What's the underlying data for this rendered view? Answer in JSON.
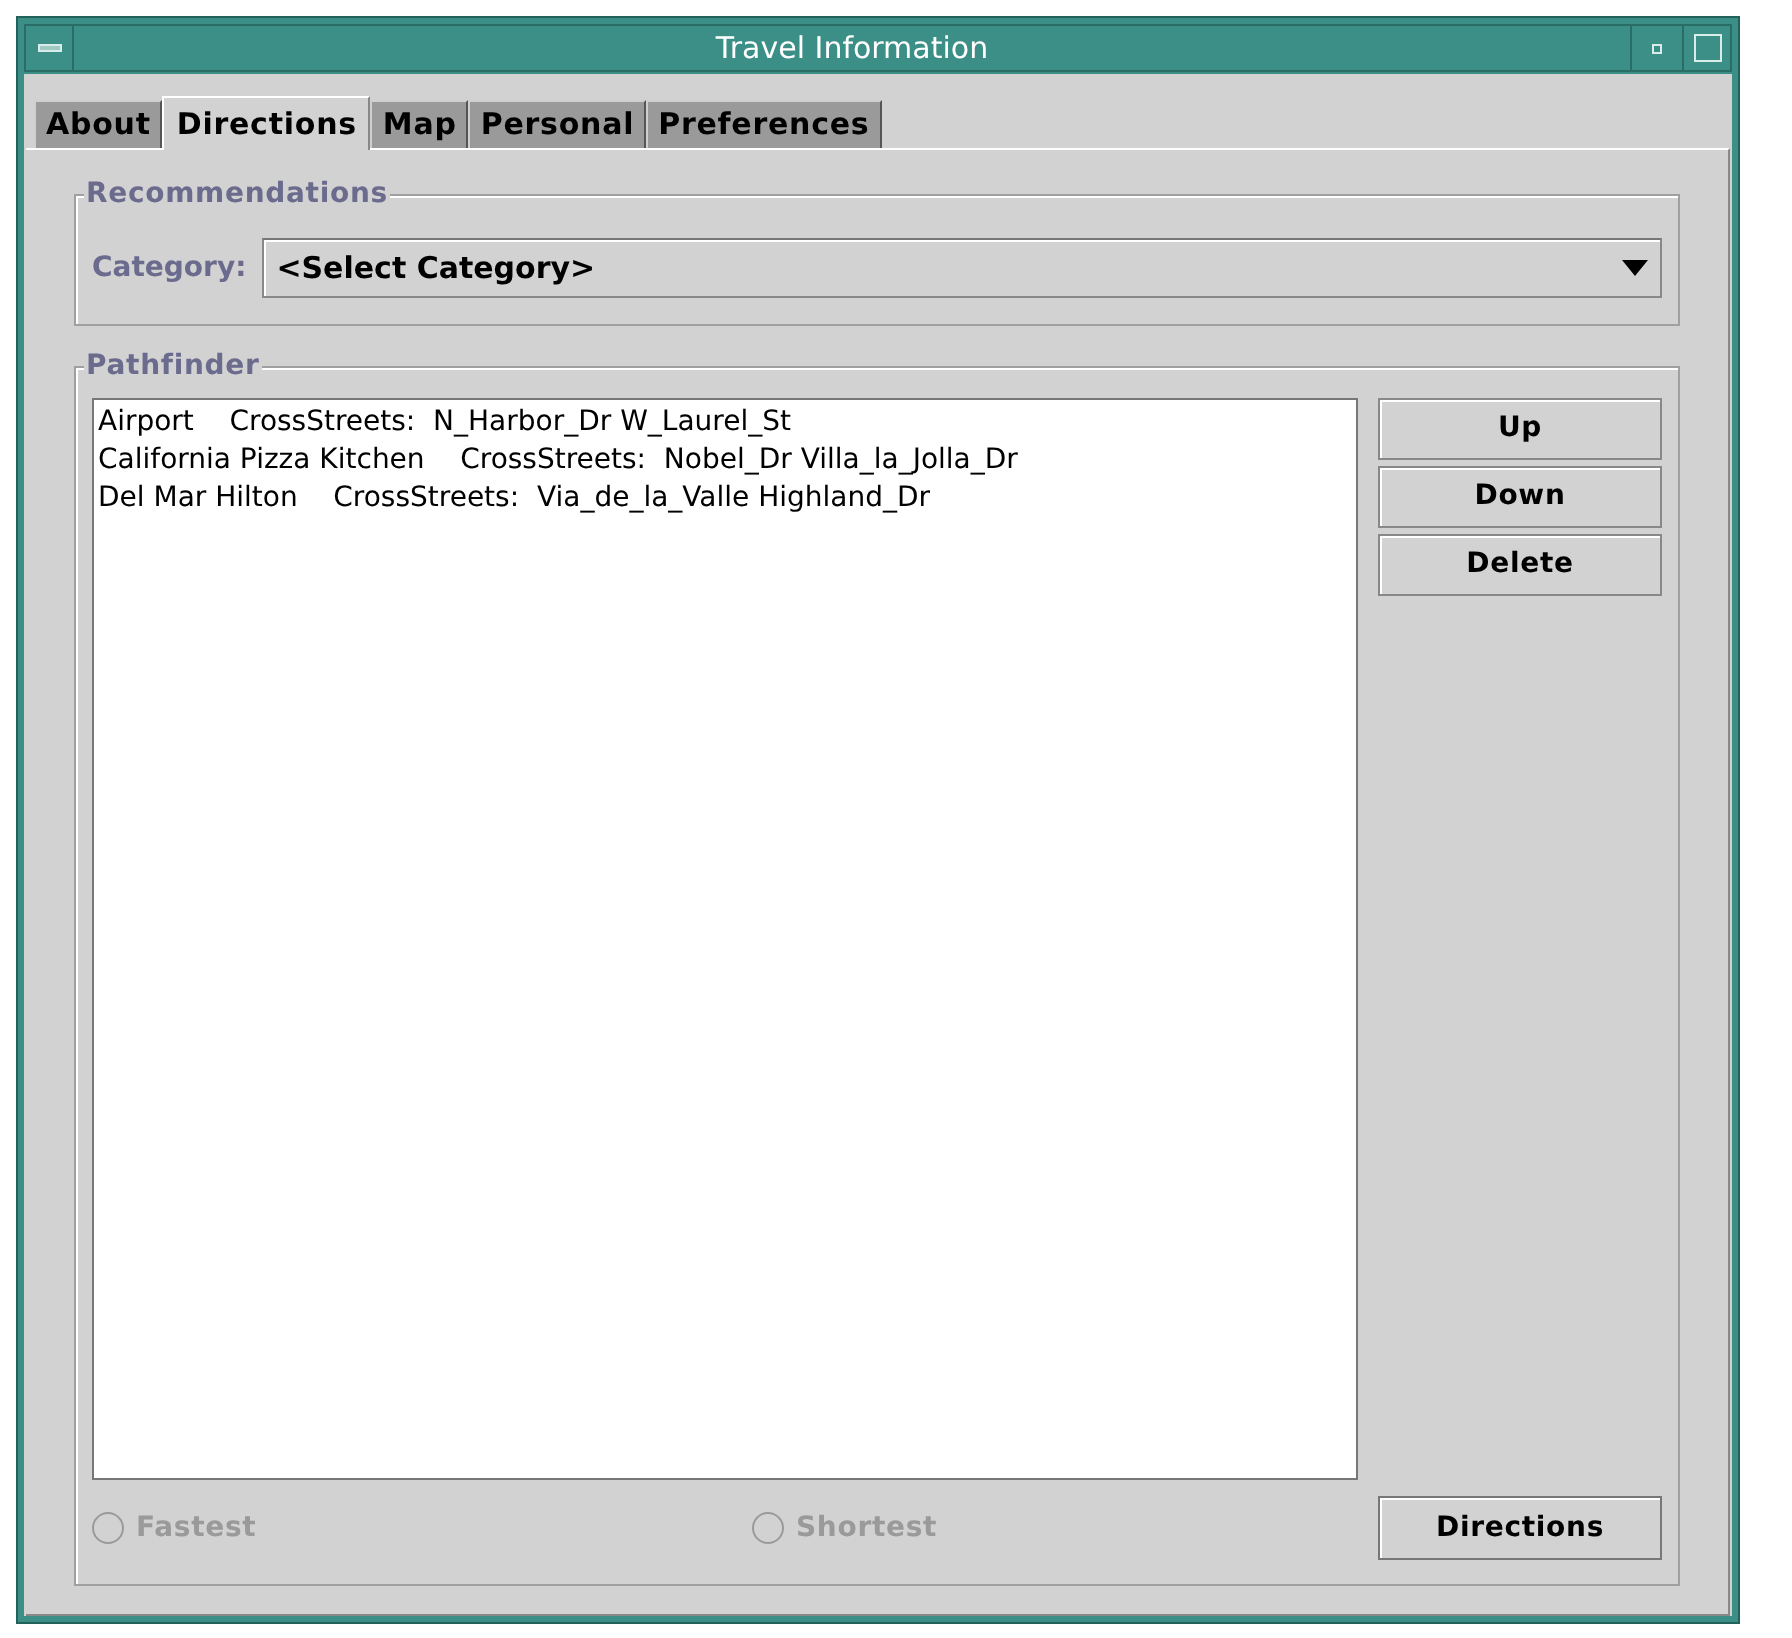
{
  "window": {
    "title": "Travel Information"
  },
  "tabs": [
    {
      "label": "About",
      "selected": false
    },
    {
      "label": "Directions",
      "selected": true
    },
    {
      "label": "Map",
      "selected": false
    },
    {
      "label": "Personal",
      "selected": false
    },
    {
      "label": "Preferences",
      "selected": false
    }
  ],
  "recommendations": {
    "title": "Recommendations",
    "category_label": "Category:",
    "category_value": "<Select Category>"
  },
  "pathfinder": {
    "title": "Pathfinder",
    "items": [
      "Airport    CrossStreets:  N_Harbor_Dr W_Laurel_St",
      "California Pizza Kitchen    CrossStreets:  Nobel_Dr Villa_la_Jolla_Dr",
      "Del Mar Hilton    CrossStreets:  Via_de_la_Valle Highland_Dr"
    ],
    "side_buttons": [
      "Up",
      "Down",
      "Delete"
    ],
    "options": [
      {
        "label": "Fastest",
        "selected": false,
        "disabled": true
      },
      {
        "label": "Shortest",
        "selected": false,
        "disabled": true
      }
    ],
    "action_button": "Directions"
  }
}
